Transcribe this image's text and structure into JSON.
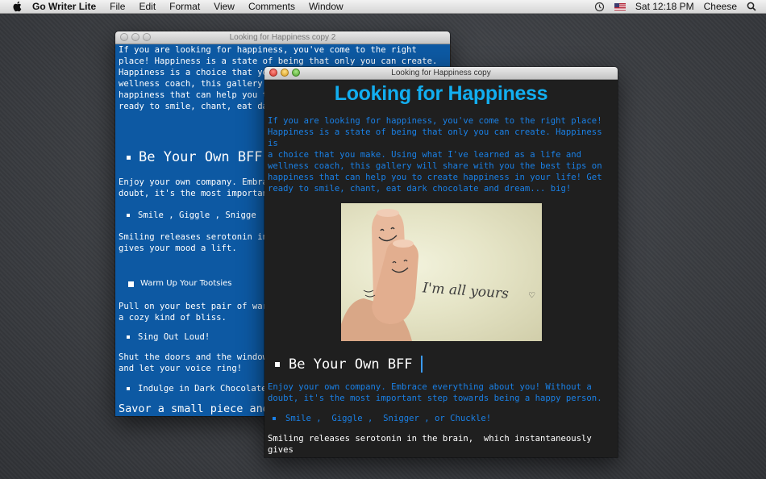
{
  "menubar": {
    "app_name": "Go Writer Lite",
    "items": [
      "File",
      "Edit",
      "Format",
      "View",
      "Comments",
      "Window"
    ],
    "clock": "Sat 12:18 PM",
    "user": "Cheese"
  },
  "back_window": {
    "title": "Looking for Happiness copy 2",
    "intro": "If you are looking for happiness, you've come to the right place! Happiness is a state of being that only you can create. Happiness is a choice that you make. Us\nwellness coach, this gallery\nhappiness that can help you t\nready to smile, chant, eat da",
    "heading": "Be Your Own BFF",
    "p1": "Enjoy your own company. Embra\ndoubt, it's the most importan",
    "bullet1": "Smile ,  Giggle ,  Snigge",
    "p2": "Smiling releases serotonin in\ngives your mood a lift.",
    "checkbox_label": "Warm Up Your Tootsies",
    "p3": "Pull on your best pair of war\na cozy kind of bliss.",
    "bullet2": "Sing Out Loud!",
    "p4": "Shut the doors and the window\nand let your voice ring!",
    "bullet3": "Indulge in Dark Chocolate",
    "p5": "Savor a small piece and"
  },
  "front_window": {
    "title": "Looking for Happiness copy",
    "doc_title": "Looking for Happiness",
    "intro": "If you are looking for happiness, you've come to the right place!\nHappiness is a state of being that only you can create. Happiness is\na choice that you make. Using what I've learned as a life and\nwellness coach, this gallery will share with you the best tips on\nhappiness that can help you to create happiness in your life! Get\nready to smile, chant, eat dark chocolate and dream... big!",
    "photo_caption": "I'm all yours",
    "heading": "Be Your Own BFF",
    "p1": "Enjoy your own company. Embrace everything about you! Without a\ndoubt, it's the most important step towards being a happy person.",
    "bullet1": "Smile ,  Giggle ,  Snigger , or Chuckle!",
    "p2": "Smiling releases serotonin in the brain,  which instantaneously gives\nyour mood a lift."
  },
  "colors": {
    "back_bg": "#0d59a3",
    "front_bg": "#1f1f1f",
    "title_blue": "#12aef0",
    "text_blue": "#1a80e6"
  }
}
